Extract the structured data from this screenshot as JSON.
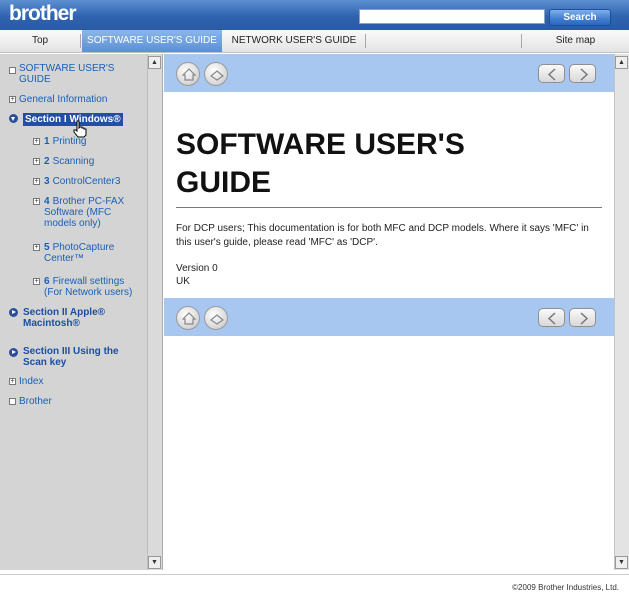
{
  "header": {
    "logo": "brother",
    "search_value": "",
    "search_button": "Search"
  },
  "nav": {
    "tabs": [
      "Top",
      "SOFTWARE USER'S GUIDE",
      "NETWORK USER'S GUIDE",
      "Site map"
    ],
    "active": "SOFTWARE USER'S GUIDE"
  },
  "sidebar": {
    "root": "SOFTWARE USER'S GUIDE",
    "general": "General Information",
    "section1": "Section I Windows®",
    "chapters": [
      {
        "num": "1",
        "label": "Printing"
      },
      {
        "num": "2",
        "label": "Scanning"
      },
      {
        "num": "3",
        "label": "ControlCenter3"
      },
      {
        "num": "4",
        "label": "Brother PC-FAX Software (MFC models only)"
      },
      {
        "num": "5",
        "label": "PhotoCapture Center™"
      },
      {
        "num": "6",
        "label": "Firewall settings (For Network users)"
      }
    ],
    "section2": "Section II Apple® Macintosh®",
    "section3": "Section III Using the Scan key",
    "index": "Index",
    "brother": "Brother"
  },
  "main": {
    "title_line1": "SOFTWARE USER'S",
    "title_line2": "GUIDE",
    "intro": "For DCP users; This documentation is for both MFC and DCP models. Where it says 'MFC' in this user's guide, please read 'MFC' as 'DCP'.",
    "version": "Version 0",
    "region": "UK"
  },
  "footer": {
    "copyright": "©2009 Brother Industries, Ltd."
  },
  "colors": {
    "header_blue": "#2f63b0",
    "strip_blue": "#a7c7f1",
    "sidebar_gray": "#d4d4d4",
    "link_blue": "#1a5fb4"
  }
}
